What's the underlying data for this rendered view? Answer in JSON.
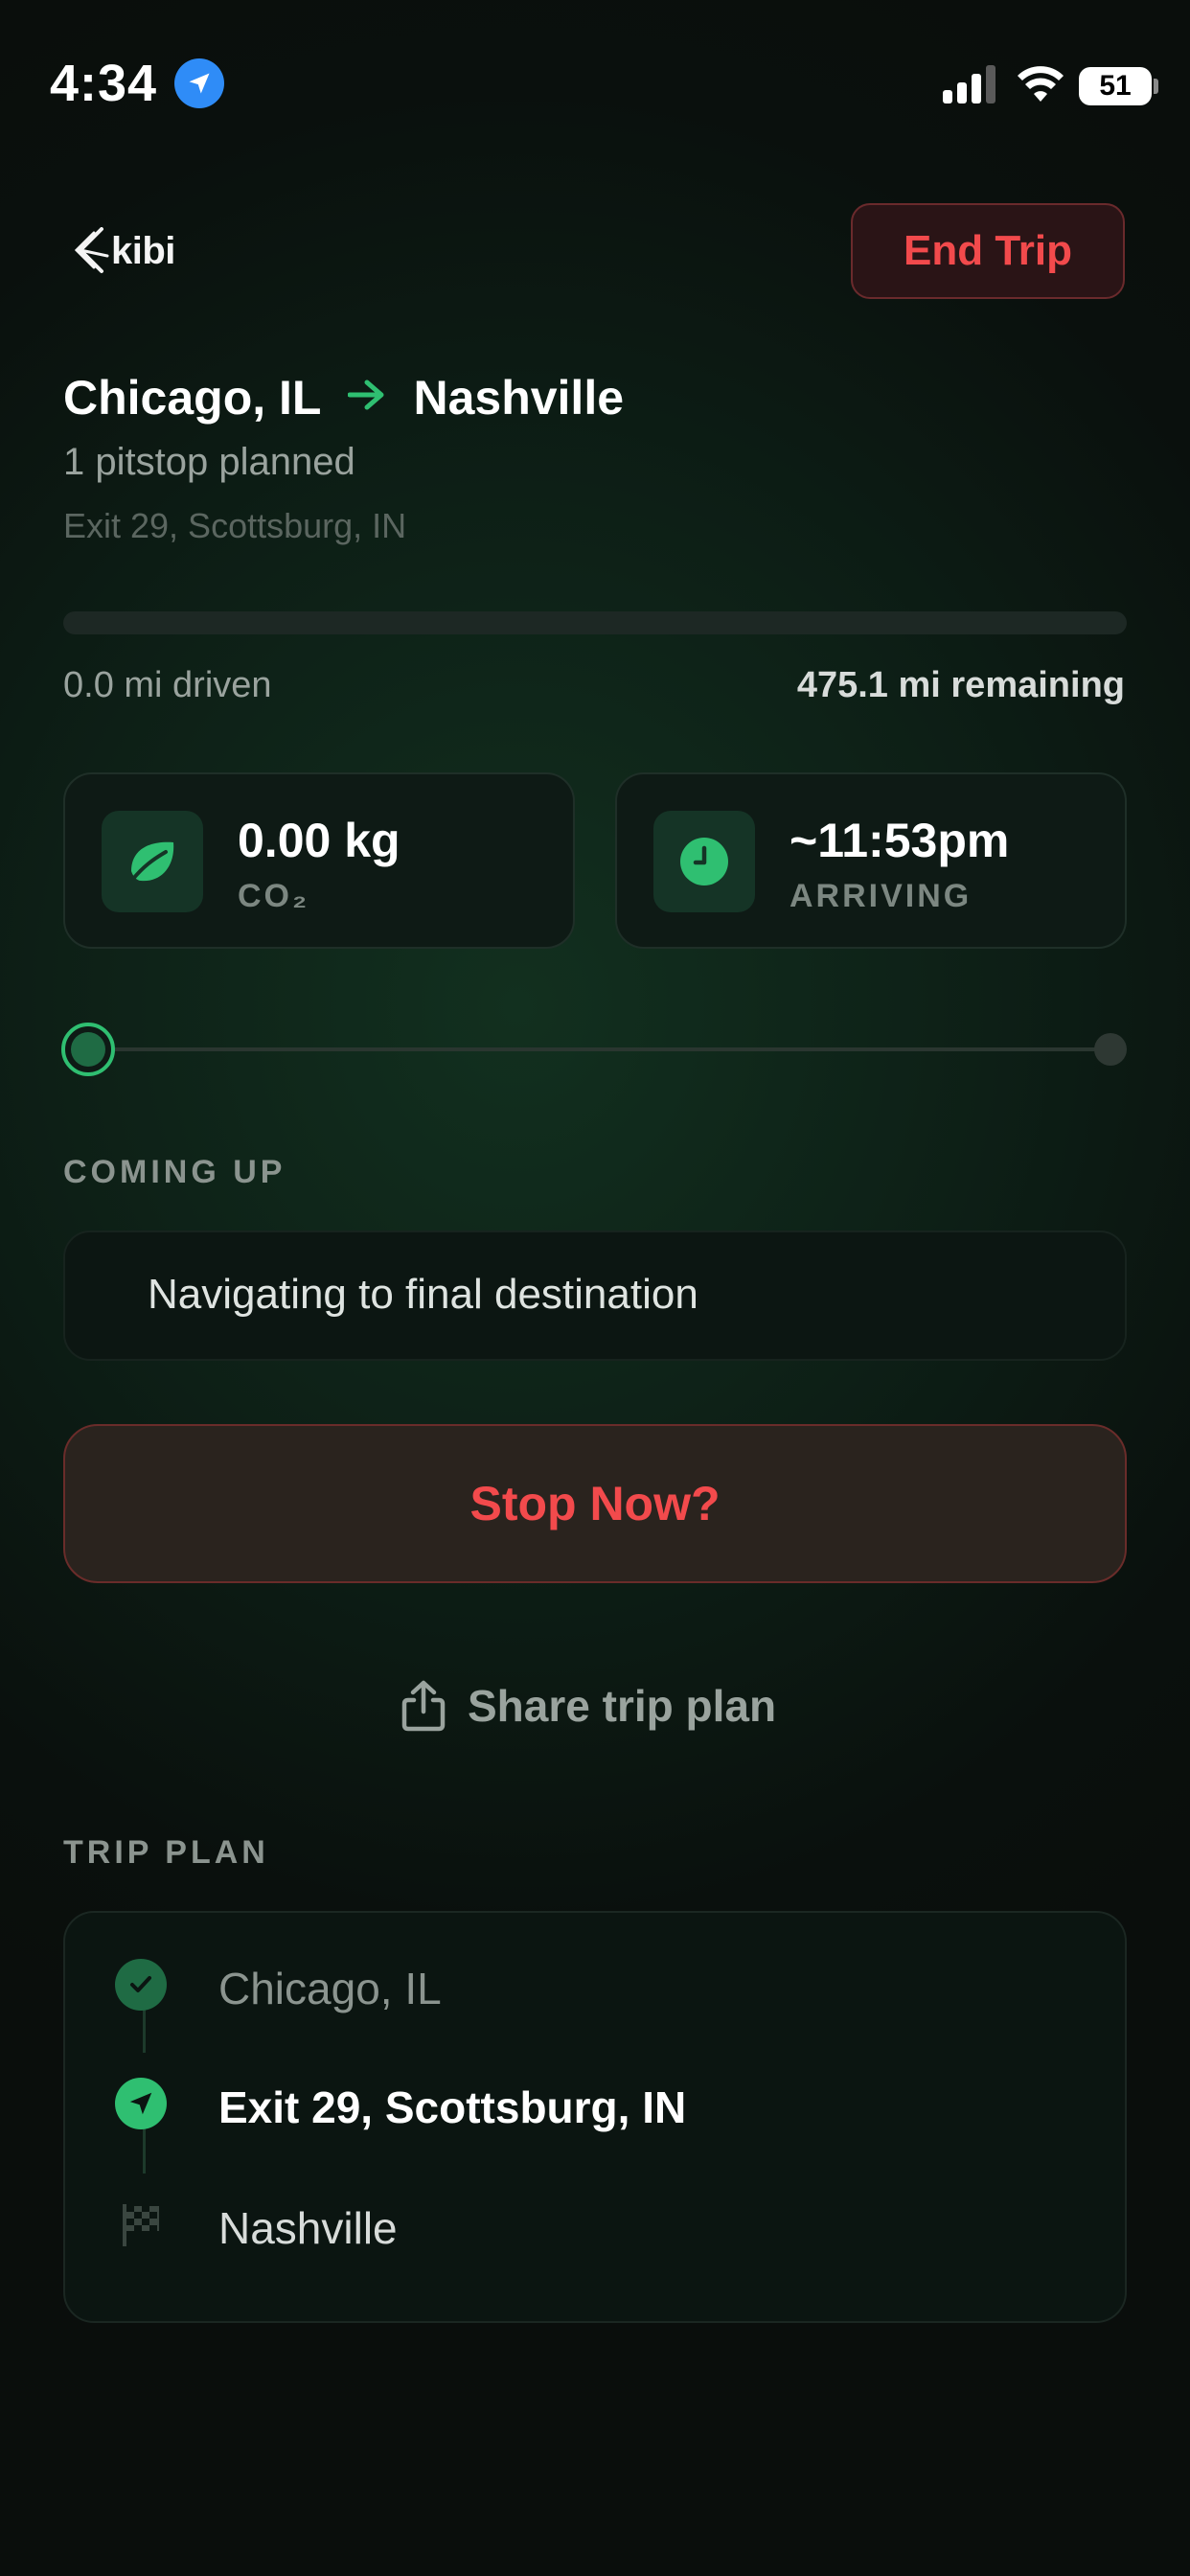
{
  "status_bar": {
    "time": "4:34",
    "battery": "51"
  },
  "header": {
    "logo_text": "kibi",
    "end_trip_label": "End Trip"
  },
  "trip": {
    "origin": "Chicago, IL",
    "destination": "Nashville",
    "pitstops_summary": "1 pitstop planned",
    "pitstop_location": "Exit 29, Scottsburg, IN",
    "progress_fraction": 0.0,
    "driven_text": "0.0 mi driven",
    "remaining_text": "475.1 mi remaining"
  },
  "stats": {
    "co2_value": "0.00 kg",
    "co2_label": "CO₂",
    "arrival_value": "~11:53pm",
    "arrival_label": "ARRIVING"
  },
  "coming_up": {
    "section_label": "COMING UP",
    "text": "Navigating to final destination"
  },
  "actions": {
    "stop_now_label": "Stop Now?",
    "share_label": "Share trip plan"
  },
  "trip_plan": {
    "section_label": "TRIP PLAN",
    "stops": [
      {
        "label": "Chicago, IL",
        "state": "completed",
        "icon": "check-icon"
      },
      {
        "label": "Exit 29, Scottsburg, IN",
        "state": "current",
        "icon": "navigation-arrow-icon"
      },
      {
        "label": "Nashville",
        "state": "upcoming",
        "icon": "checkered-flag-icon"
      }
    ]
  },
  "colors": {
    "accent_green": "#2fbf71",
    "danger_red": "#f24a4c",
    "location_blue": "#2f8cf7"
  }
}
